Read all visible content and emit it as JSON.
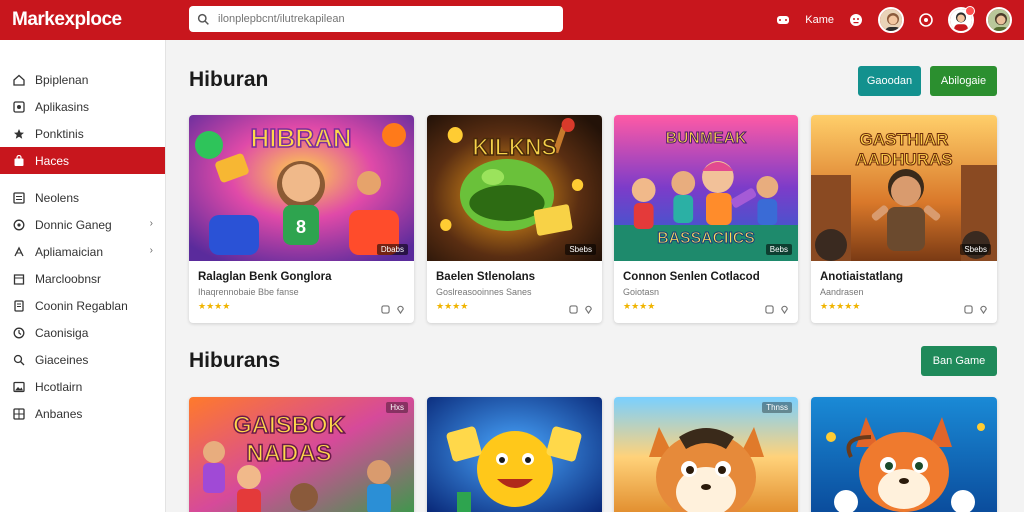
{
  "app": {
    "logo": "Markexploce",
    "search_placeholder": "ilonplepbcnt/ilutrekapilean",
    "accent": "#c8161d"
  },
  "header": {
    "user_label": "Kame"
  },
  "sidebar": {
    "items": [
      {
        "label": "Bpiplenan",
        "icon": "home-icon"
      },
      {
        "label": "Aplikasins",
        "icon": "apps-icon"
      },
      {
        "label": "Ponktinis",
        "icon": "star-icon"
      },
      {
        "label": "Haces",
        "icon": "bag-icon",
        "active": true
      },
      {
        "label": "Neolens",
        "icon": "list-icon"
      },
      {
        "label": "Donnic Ganeg",
        "icon": "gamepad-icon",
        "chevron": true
      },
      {
        "label": "Apliamaician",
        "icon": "puzzle-icon",
        "chevron": true
      },
      {
        "label": "Marcloobnsr",
        "icon": "store-icon"
      },
      {
        "label": "Coonin Regablan",
        "icon": "doc-icon"
      },
      {
        "label": "Caonisiga",
        "icon": "clock-icon"
      },
      {
        "label": "Giaceines",
        "icon": "search-icon"
      },
      {
        "label": "Hcotlairn",
        "icon": "image-icon"
      },
      {
        "label": "Anbanes",
        "icon": "grid-icon"
      }
    ]
  },
  "section1": {
    "title": "Hiburan",
    "btn1": "Gaoodan",
    "btn2": "Abilogaie"
  },
  "section2": {
    "title": "Hiburans",
    "btn1": "Ban Game"
  },
  "cards": [
    {
      "name": "Ralaglan Benk Gonglora",
      "sub": "Ihaqrennobaie Bbe fanse",
      "stars": "★★★★",
      "tag": "Dbabs",
      "art": "HIBRAN"
    },
    {
      "name": "Baelen Stlenolans",
      "sub": "Goslreasooinnes Sanes",
      "stars": "★★★★",
      "tag": "Sbebs",
      "art": "KILKNS"
    },
    {
      "name": "Connon Senlen Cotlacod",
      "sub": "Goiotasn",
      "stars": "★★★★",
      "tag": "Bebs",
      "art": "BUNMEAK"
    },
    {
      "name": "Anotiaistatlang",
      "sub": "Aandrasen",
      "stars": "★★★★★",
      "tag": "Sbebs",
      "art": "GASTHIAR AADHURAS"
    }
  ],
  "cards_row2": [
    {
      "art": "GAISBOK NADAS",
      "tag": "Hxs"
    },
    {
      "art": "",
      "tag": ""
    },
    {
      "art": "",
      "tag": "Thnss"
    },
    {
      "art": "",
      "tag": ""
    }
  ]
}
